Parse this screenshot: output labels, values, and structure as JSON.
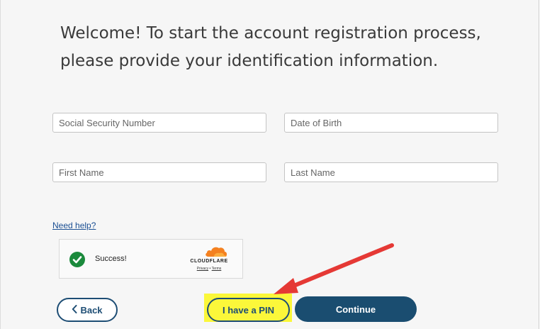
{
  "heading": "Welcome! To start the account registration process, please provide your identification information.",
  "fields": {
    "ssn_placeholder": "Social Security Number",
    "dob_placeholder": "Date of Birth",
    "first_name_placeholder": "First Name",
    "last_name_placeholder": "Last Name"
  },
  "help_link": "Need help?",
  "captcha": {
    "status": "Success!",
    "brand": "CLOUDFLARE",
    "privacy": "Privacy",
    "separator": " • ",
    "terms": "Terms",
    "check_icon": "check-circle-icon",
    "logo_icon": "cloudflare-logo-icon"
  },
  "buttons": {
    "back": "Back",
    "back_icon": "chevron-left-icon",
    "pin": "I have a PIN",
    "continue": "Continue"
  },
  "colors": {
    "primary": "#1a4d70",
    "highlight": "#fbf73a",
    "annotation_arrow": "#e53935",
    "success": "#1b8a3c",
    "link": "#1b4f93"
  }
}
